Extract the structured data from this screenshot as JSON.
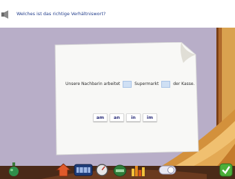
{
  "header": {
    "question": "Welches ist das richtige Verhältniswort?"
  },
  "exercise": {
    "sentence_part1": "Unsere Nachbarin arbeitet",
    "sentence_part2": "Supermarkt",
    "sentence_part3": "der Kasse.",
    "choices": [
      "am",
      "an",
      "in",
      "im"
    ]
  },
  "icons": {
    "audio": "speaker-icon",
    "potion": "potion-bottle-icon",
    "home": "home-arrow-icon",
    "robot": "robot-icon",
    "speedometer": "speedometer-icon",
    "help": "helmet-icon",
    "stats": "bar-chart-icon",
    "toggle": "toggle-icon",
    "check": "checkmark-icon"
  },
  "colors": {
    "stage_background": "#b8aec8",
    "question_text": "#1f3b8a",
    "choice_text": "#2b2f7a",
    "blank_fill": "#cfe0f4",
    "check_green": "#4caf3a"
  }
}
